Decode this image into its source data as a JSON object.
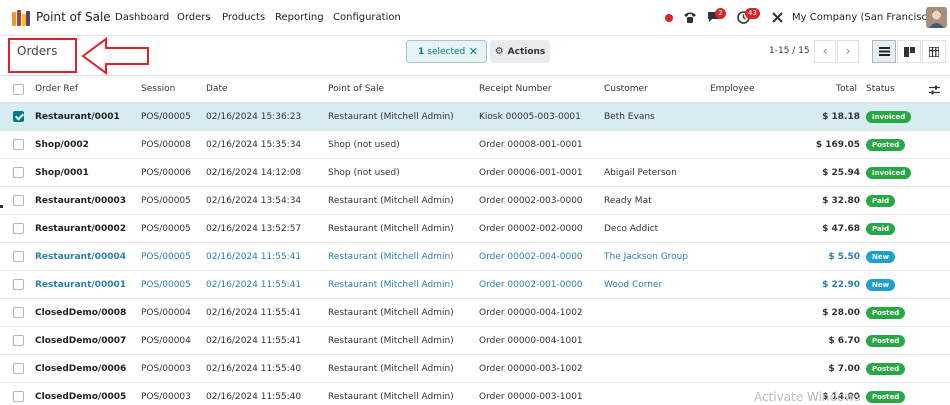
{
  "app": {
    "title": "Point of Sale",
    "menu": [
      "Dashboard",
      "Orders",
      "Products",
      "Reporting",
      "Configuration"
    ],
    "company": "My Company (San Francisco)",
    "chat_badge": "2",
    "activity_badge": "43"
  },
  "control_panel": {
    "breadcrumb": "Orders",
    "selected_count": "1",
    "selected_label": "selected",
    "actions_label": "Actions",
    "pager": "1-15 / 15"
  },
  "table": {
    "headers": {
      "order_ref": "Order Ref",
      "session": "Session",
      "date": "Date",
      "pos": "Point of Sale",
      "receipt": "Receipt Number",
      "customer": "Customer",
      "employee": "Employee",
      "total": "Total",
      "status": "Status"
    },
    "rows": [
      {
        "ref": "Restaurant/0001",
        "session": "POS/00005",
        "date": "02/16/2024 15:36:23",
        "pos": "Restaurant (Mitchell Admin)",
        "receipt": "Kiosk 00005-003-0001",
        "customer": "Beth Evans",
        "total": "$ 18.18",
        "status": "Invoiced"
      },
      {
        "ref": "Shop/0002",
        "session": "POS/00008",
        "date": "02/16/2024 15:35:34",
        "pos": "Shop (not used)",
        "receipt": "Order 00008-001-0001",
        "customer": "",
        "total": "$ 169.05",
        "status": "Posted"
      },
      {
        "ref": "Shop/0001",
        "session": "POS/00006",
        "date": "02/16/2024 14:12:08",
        "pos": "Shop (not used)",
        "receipt": "Order 00006-001-0001",
        "customer": "Abigail Peterson",
        "total": "$ 25.94",
        "status": "Invoiced"
      },
      {
        "ref": "Restaurant/00003",
        "session": "POS/00005",
        "date": "02/16/2024 13:54:34",
        "pos": "Restaurant (Mitchell Admin)",
        "receipt": "Order 00002-003-0000",
        "customer": "Ready Mat",
        "total": "$ 32.80",
        "status": "Paid"
      },
      {
        "ref": "Restaurant/00002",
        "session": "POS/00005",
        "date": "02/16/2024 13:52:57",
        "pos": "Restaurant (Mitchell Admin)",
        "receipt": "Order 00002-002-0000",
        "customer": "Deco Addict",
        "total": "$ 47.68",
        "status": "Paid"
      },
      {
        "ref": "Restaurant/00004",
        "session": "POS/00005",
        "date": "02/16/2024 11:55:41",
        "pos": "Restaurant (Mitchell Admin)",
        "receipt": "Order 00002-004-0000",
        "customer": "The Jackson Group",
        "total": "$ 5.50",
        "status": "New"
      },
      {
        "ref": "Restaurant/00001",
        "session": "POS/00005",
        "date": "02/16/2024 11:55:41",
        "pos": "Restaurant (Mitchell Admin)",
        "receipt": "Order 00002-001-0000",
        "customer": "Wood Corner",
        "total": "$ 22.90",
        "status": "New"
      },
      {
        "ref": "ClosedDemo/0008",
        "session": "POS/00004",
        "date": "02/16/2024 11:55:41",
        "pos": "Restaurant (Mitchell Admin)",
        "receipt": "Order 00000-004-1002",
        "customer": "",
        "total": "$ 28.00",
        "status": "Posted"
      },
      {
        "ref": "ClosedDemo/0007",
        "session": "POS/00004",
        "date": "02/16/2024 11:55:41",
        "pos": "Restaurant (Mitchell Admin)",
        "receipt": "Order 00000-004-1001",
        "customer": "",
        "total": "$ 6.70",
        "status": "Posted"
      },
      {
        "ref": "ClosedDemo/0006",
        "session": "POS/00003",
        "date": "02/16/2024 11:55:40",
        "pos": "Restaurant (Mitchell Admin)",
        "receipt": "Order 00000-003-1002",
        "customer": "",
        "total": "$ 7.00",
        "status": "Posted"
      },
      {
        "ref": "ClosedDemo/0005",
        "session": "POS/00003",
        "date": "02/16/2024 11:55:40",
        "pos": "Restaurant (Mitchell Admin)",
        "receipt": "Order 00000-003-1001",
        "customer": "",
        "total": "$ 14.00",
        "status": "Posted"
      }
    ]
  },
  "watermark": "Activate Windows",
  "colors": {
    "accent": "#017e84",
    "selected_row": "#d6ecf0",
    "status_green": "#28a745",
    "status_blue": "#1f9fce",
    "link_blue": "#2b7fab",
    "annotation_red": "#e0202b"
  }
}
